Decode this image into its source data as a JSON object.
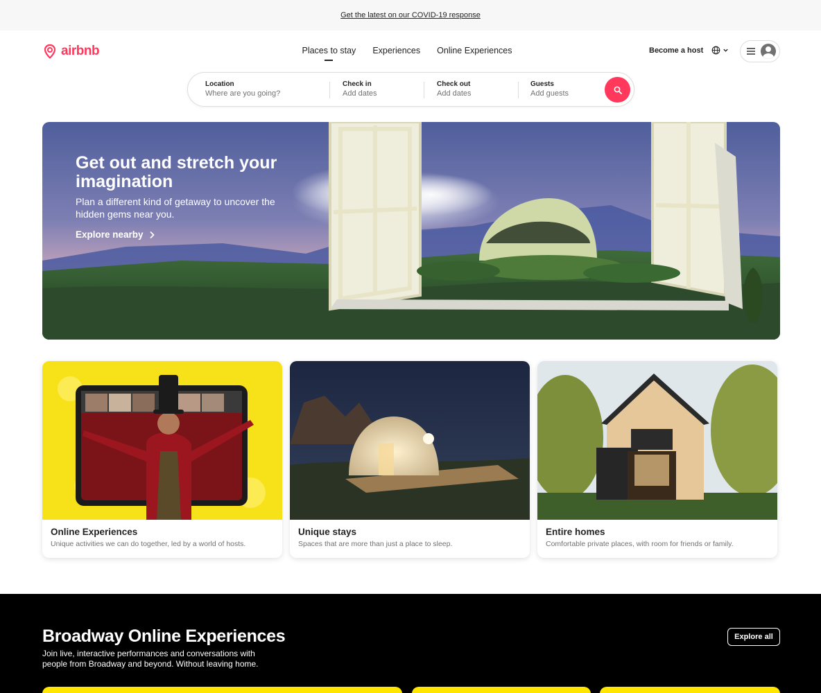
{
  "banner": {
    "link_text": "Get the latest on our COVID-19 response"
  },
  "header": {
    "logo_text": "airbnb",
    "tabs": [
      {
        "label": "Places to stay",
        "active": true
      },
      {
        "label": "Experiences",
        "active": false
      },
      {
        "label": "Online Experiences",
        "active": false
      }
    ],
    "become_host": "Become a host",
    "globe_icon": "globe-icon",
    "menu_icon": "hamburger-icon",
    "avatar_icon": "user-avatar-icon"
  },
  "search": {
    "fields": [
      {
        "label": "Location",
        "placeholder": "Where are you going?"
      },
      {
        "label": "Check in",
        "placeholder": "Add dates"
      },
      {
        "label": "Check out",
        "placeholder": "Add dates"
      },
      {
        "label": "Guests",
        "placeholder": "Add guests"
      }
    ],
    "button_icon": "search-icon",
    "accent_color": "#FF385C"
  },
  "hero": {
    "title": "Get out and stretch your imagination",
    "subtitle": "Plan a different kind of getaway to uncover the hidden gems near you.",
    "link": "Explore nearby"
  },
  "cards": [
    {
      "title": "Online Experiences",
      "description": "Unique activities we can do together, led by a world of hosts."
    },
    {
      "title": "Unique stays",
      "description": "Spaces that are more than just a place to sleep."
    },
    {
      "title": "Entire homes",
      "description": "Comfortable private places, with room for friends or family."
    }
  ],
  "broadway": {
    "title": "Broadway Online Experiences",
    "subtitle": "Join live, interactive performances and conversations with people from Broadway and beyond. Without leaving home.",
    "button": "Explore all",
    "tile_color": "#FFE500"
  }
}
